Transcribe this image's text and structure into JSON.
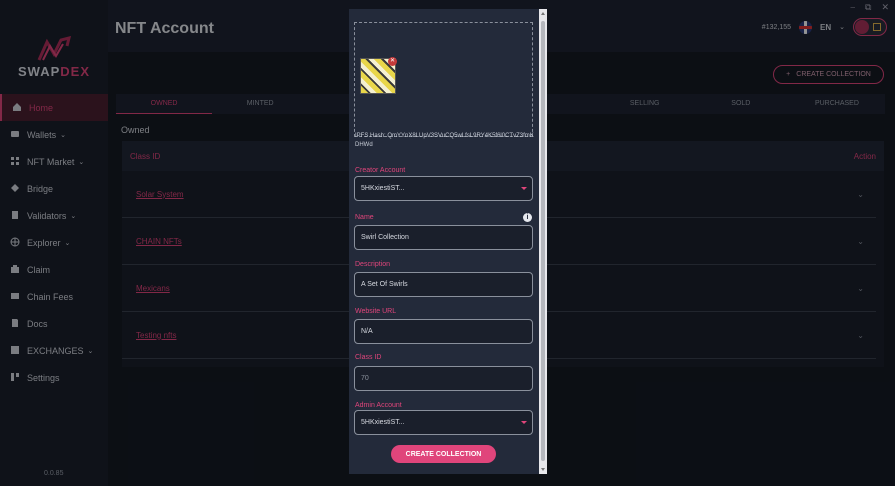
{
  "window": {
    "minimize": "⎯",
    "maximize": "⧉",
    "close": "✕"
  },
  "sidebar": {
    "brand_a": "SWAP",
    "brand_b": "DEX",
    "items": [
      {
        "label": "Home",
        "icon": "home-icon",
        "chev": ""
      },
      {
        "label": "Wallets",
        "icon": "wallet-icon",
        "chev": "⌄"
      },
      {
        "label": "NFT Market",
        "icon": "grid-icon",
        "chev": "⌄"
      },
      {
        "label": "Bridge",
        "icon": "bridge-icon",
        "chev": ""
      },
      {
        "label": "Validators",
        "icon": "file-icon",
        "chev": "⌄"
      },
      {
        "label": "Explorer",
        "icon": "globe-icon",
        "chev": "⌄"
      },
      {
        "label": "Claim",
        "icon": "claim-icon",
        "chev": ""
      },
      {
        "label": "Chain Fees",
        "icon": "fees-icon",
        "chev": ""
      },
      {
        "label": "Docs",
        "icon": "docs-icon",
        "chev": ""
      },
      {
        "label": "EXCHANGES",
        "icon": "exchange-icon",
        "chev": "⌄"
      },
      {
        "label": "Settings",
        "icon": "settings-icon",
        "chev": ""
      }
    ],
    "version": "0.0.85"
  },
  "header": {
    "title": "NFT Account",
    "balance": "#132,155",
    "language": "EN",
    "lang_chev": "⌄"
  },
  "main": {
    "create_button": "CREATE COLLECTION",
    "tabs": [
      "OWNED",
      "MINTED",
      "",
      "",
      "",
      "SELLING",
      "SOLD",
      "PURCHASED"
    ],
    "section_label": "Owned",
    "table": {
      "col_class": "Class ID",
      "col_action": "Action",
      "rows": [
        "Solar System",
        "CHAIN NFTs",
        "Mexicans",
        "Testing nfts"
      ]
    }
  },
  "modal": {
    "ipfs": "IPFS Hash: QmYYnX8LUpV3SVuCQ5wLfsL9RY4K5f6l0CTvZ3fmKDHWd",
    "creator_label": "Creator Account",
    "creator_value": "5HKxiestiST...",
    "name_label": "Name",
    "name_value": "Swirl Collection",
    "description_label": "Description",
    "description_value": "A Set Of Swirls",
    "website_label": "Website URL",
    "website_value": "N/A",
    "classid_label": "Class ID",
    "classid_value": "70",
    "admin_label": "Admin Account",
    "admin_value": "5HKxiestiST...",
    "submit": "CREATE COLLECTION"
  },
  "colors": {
    "accent": "#e0457b",
    "bg": "#1e2433",
    "panel": "#232a3a"
  }
}
